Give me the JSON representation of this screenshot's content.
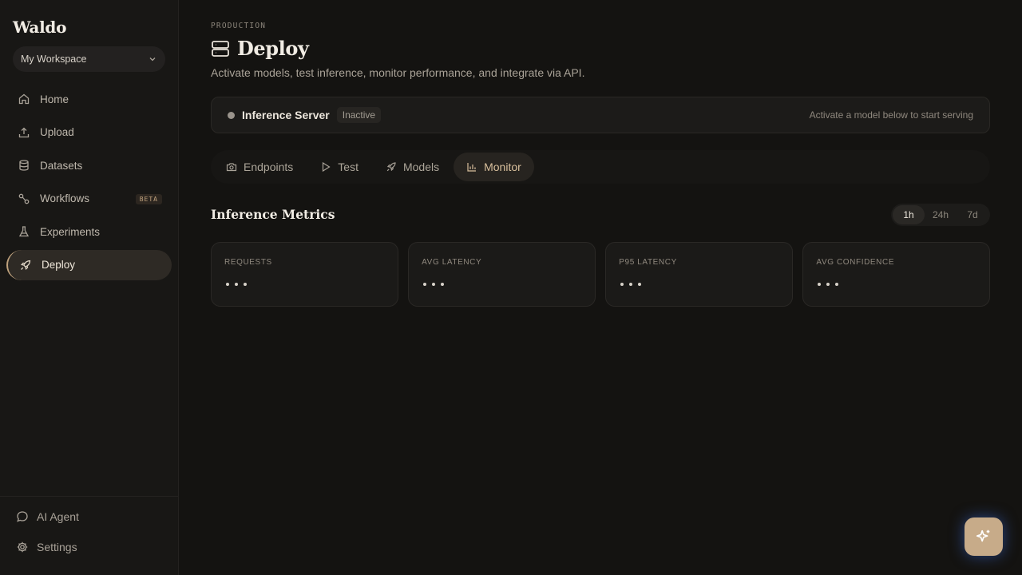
{
  "app": {
    "name": "Waldo"
  },
  "workspace": {
    "selected": "My Workspace"
  },
  "sidebar": {
    "items": [
      {
        "label": "Home",
        "icon": "home-icon"
      },
      {
        "label": "Upload",
        "icon": "upload-icon"
      },
      {
        "label": "Datasets",
        "icon": "database-icon"
      },
      {
        "label": "Workflows",
        "icon": "workflow-icon",
        "badge": "BETA"
      },
      {
        "label": "Experiments",
        "icon": "flask-icon"
      },
      {
        "label": "Deploy",
        "icon": "rocket-icon",
        "active": true
      }
    ],
    "bottom": [
      {
        "label": "AI Agent",
        "icon": "chat-icon"
      },
      {
        "label": "Settings",
        "icon": "gear-icon"
      }
    ]
  },
  "header": {
    "eyebrow": "PRODUCTION",
    "title": "Deploy",
    "subtitle": "Activate models, test inference, monitor performance, and integrate via API."
  },
  "server": {
    "name": "Inference Server",
    "status": "Inactive",
    "hint": "Activate a model below to start serving"
  },
  "tabs": [
    {
      "label": "Endpoints",
      "icon": "camera-icon"
    },
    {
      "label": "Test",
      "icon": "play-icon"
    },
    {
      "label": "Models",
      "icon": "rocket-icon"
    },
    {
      "label": "Monitor",
      "icon": "bar-chart-icon",
      "active": true
    }
  ],
  "metrics": {
    "title": "Inference Metrics",
    "ranges": [
      "1h",
      "24h",
      "7d"
    ],
    "selected_range": "1h",
    "cards": [
      {
        "label": "REQUESTS",
        "value": "loading"
      },
      {
        "label": "AVG LATENCY",
        "value": "loading"
      },
      {
        "label": "P95 LATENCY",
        "value": "loading"
      },
      {
        "label": "AVG CONFIDENCE",
        "value": "loading"
      }
    ]
  },
  "colors": {
    "background": "#141311",
    "sidebar": "#181715",
    "accent": "#c7ab89",
    "active_tab_text": "#d8bf9c"
  }
}
